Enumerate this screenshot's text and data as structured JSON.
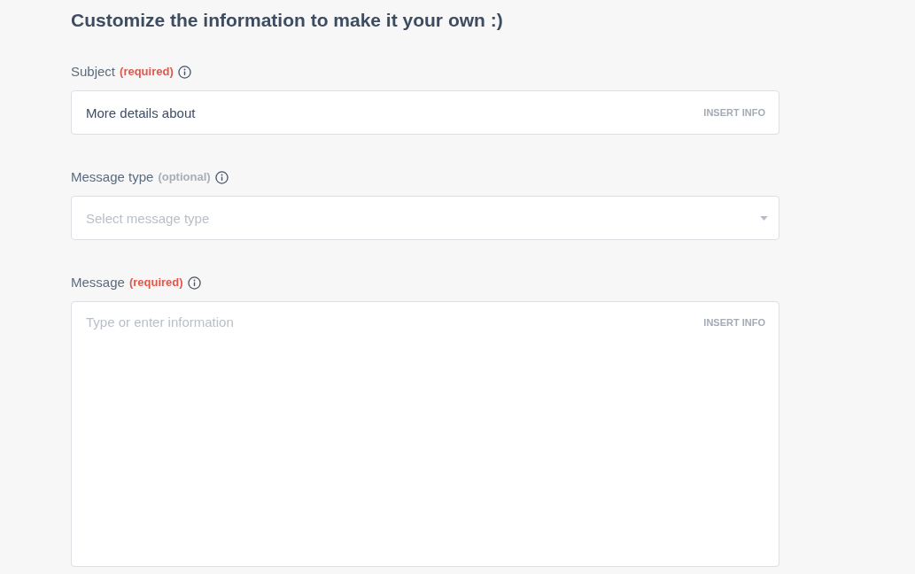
{
  "heading": "Customize the information to make it your own :)",
  "fields": [
    {
      "kind": "input",
      "label": "Subject",
      "tag": "(required)",
      "required": true,
      "value": "More details about",
      "action": "INSERT INFO"
    },
    {
      "kind": "select",
      "label": "Message type",
      "tag": "(optional)",
      "required": false,
      "placeholder": "Select message type"
    },
    {
      "kind": "textarea",
      "label": "Message",
      "tag": "(required)",
      "required": true,
      "placeholder": "Type or enter information",
      "action": "INSERT INFO"
    }
  ]
}
